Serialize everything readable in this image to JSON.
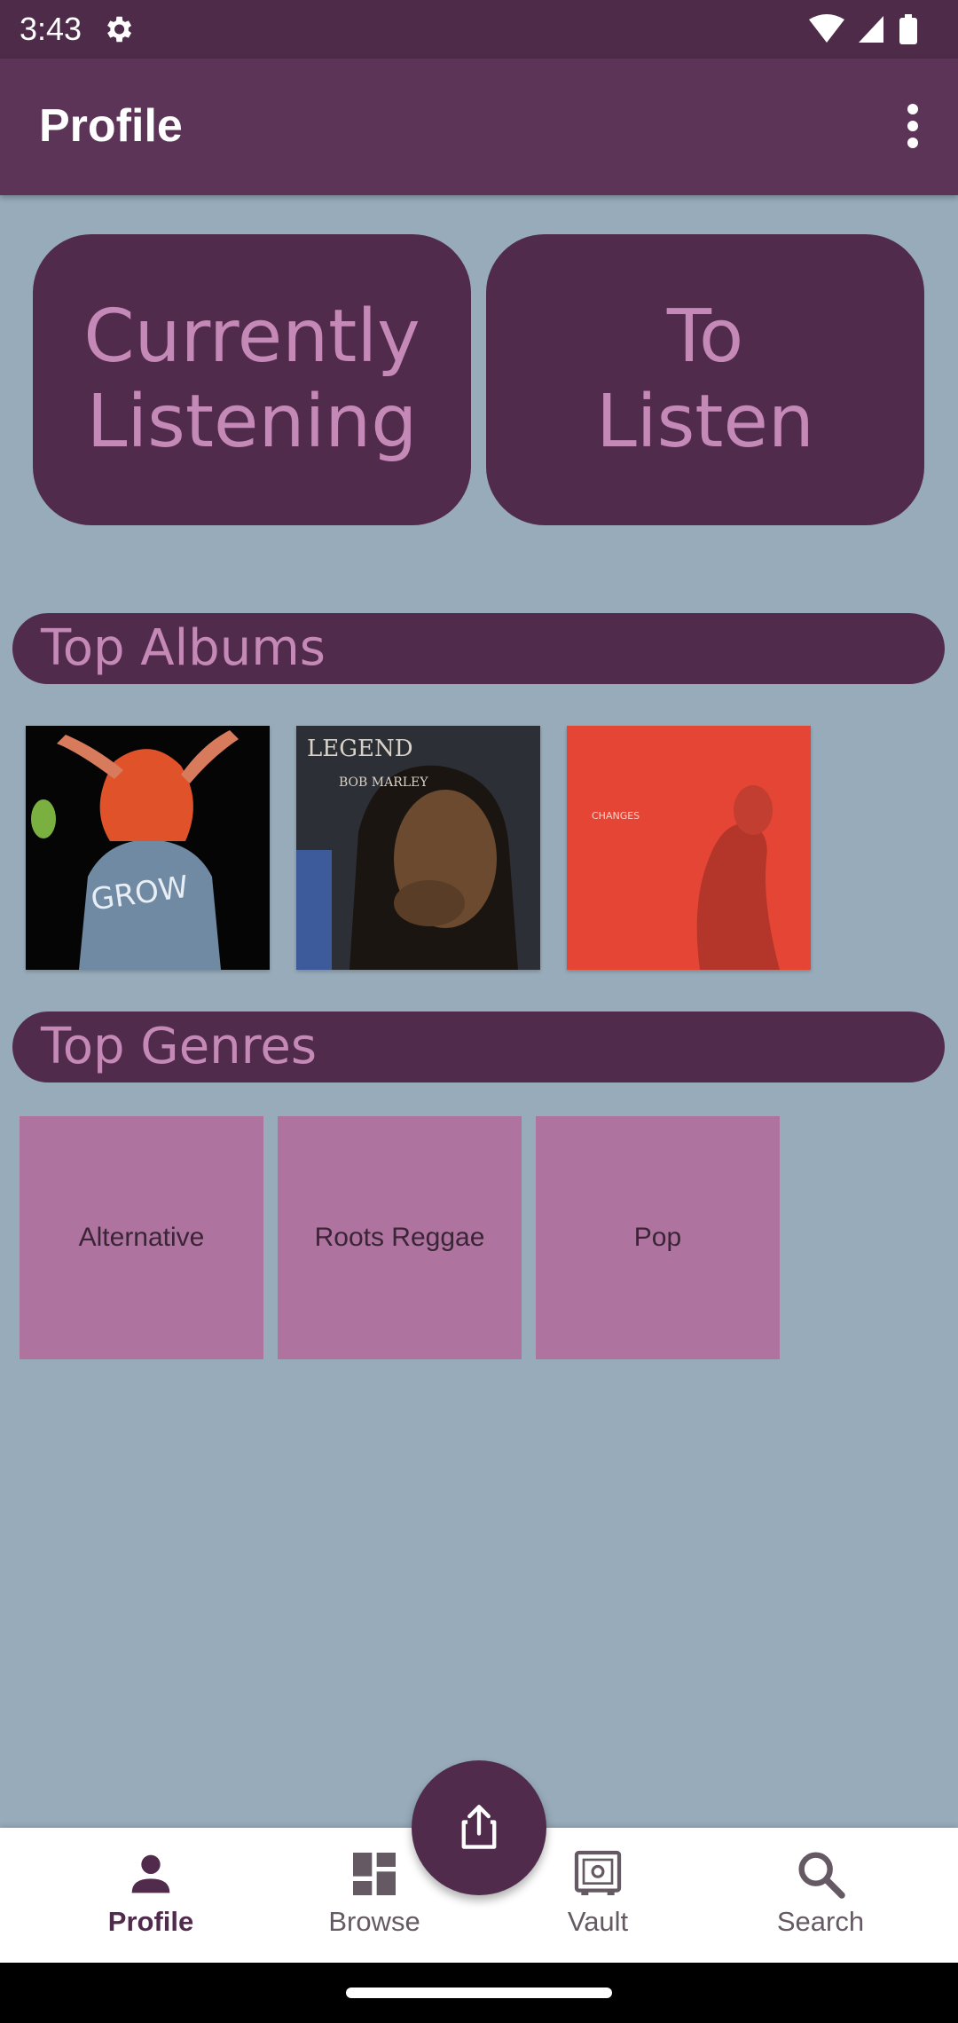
{
  "status_bar": {
    "time": "3:43"
  },
  "app_bar": {
    "title": "Profile"
  },
  "shortcuts": [
    {
      "label": "Currently\nListening"
    },
    {
      "label": "To\nListen"
    }
  ],
  "sections": {
    "top_albums": "Top Albums",
    "top_genres": "Top Genres"
  },
  "albums": [
    {
      "cover_text": "GROW"
    },
    {
      "cover_text": "LEGEND",
      "subtext": "BOB MARLEY"
    },
    {
      "cover_text": "CHANGES"
    }
  ],
  "genres": [
    "Alternative",
    "Roots Reggae",
    "Pop"
  ],
  "bottom_nav": [
    {
      "label": "Profile",
      "icon": "person-icon",
      "active": true
    },
    {
      "label": "Browse",
      "icon": "dashboard-icon",
      "active": false
    },
    {
      "label": "Vault",
      "icon": "vault-icon",
      "active": false
    },
    {
      "label": "Search",
      "icon": "search-icon",
      "active": false
    }
  ],
  "fab": {
    "icon": "share-icon"
  },
  "colors": {
    "background": "#97abba",
    "primary": "#512b4c",
    "accent_text": "#c489b6",
    "genre_tile": "#ae739f"
  }
}
